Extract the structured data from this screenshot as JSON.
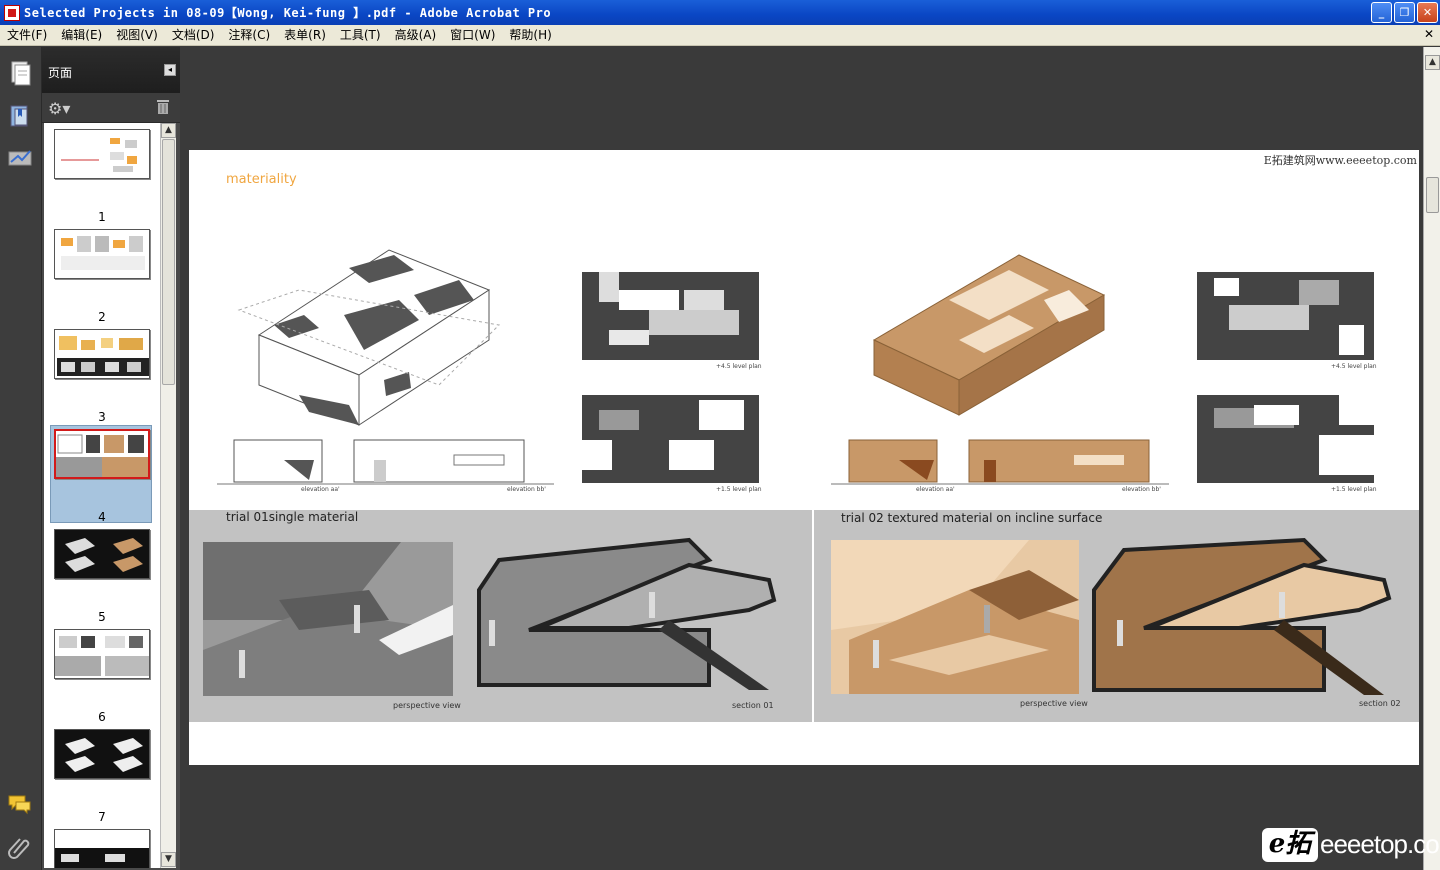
{
  "window": {
    "title": "Selected Projects in 08-09【Wong, Kei-fung 】.pdf - Adobe Acrobat Pro",
    "controls": [
      "_",
      "❐",
      "✕"
    ]
  },
  "menu": {
    "items": [
      "文件(F)",
      "编辑(E)",
      "视图(V)",
      "文档(D)",
      "注释(C)",
      "表单(R)",
      "工具(T)",
      "高级(A)",
      "窗口(W)",
      "帮助(H)"
    ],
    "close_doc": "✕"
  },
  "nav": {
    "buttons": [
      "pages-icon",
      "bookmarks-icon",
      "signatures-icon",
      "comments-icon",
      "attachments-icon"
    ]
  },
  "pages_panel": {
    "title": "页面",
    "collapse": "◂",
    "page_numbers": [
      "1",
      "2",
      "3",
      "4",
      "5",
      "6",
      "7"
    ],
    "selected_page": 4
  },
  "page": {
    "watermark": "E拓建筑网www.eeeetop.com",
    "heading": "materiality",
    "captions": {
      "elev_aa_1": "elevation aa'",
      "elev_bb_1": "elevation bb'",
      "plan45_1": "+4.5 level plan",
      "plan15_1": "+1.5 level plan",
      "elev_aa_2": "elevation aa'",
      "elev_bb_2": "elevation bb'",
      "plan45_2": "+4.5 level plan",
      "plan15_2": "+1.5 level plan"
    },
    "trial1": {
      "label": "trial 01single material",
      "persp": "perspective view",
      "section": "section 01"
    },
    "trial2": {
      "label": "trial 02 textured material on incline surface",
      "persp": "perspective view",
      "section": "section 02"
    }
  },
  "brand": {
    "logo": "e拓",
    "domain": "eeeetop.com"
  },
  "colors": {
    "titlebar": "#0a46c4",
    "accent_orange": "#f0a640",
    "selection_red": "#d21a1a",
    "wood": "#c89868"
  }
}
